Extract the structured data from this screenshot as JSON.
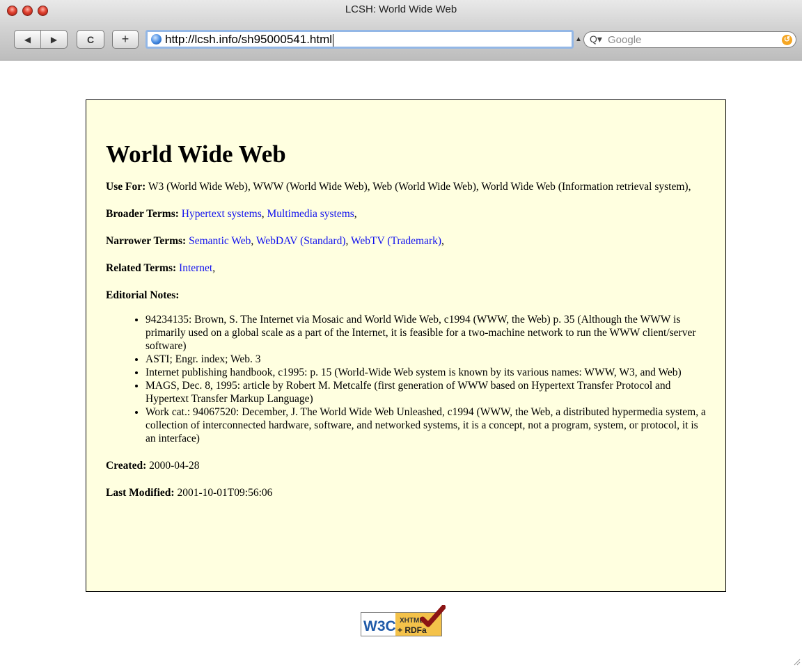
{
  "window": {
    "title": "LCSH: World Wide Web"
  },
  "toolbar": {
    "back_icon": "◀",
    "forward_icon": "▶",
    "reload_icon": "C",
    "add_icon": "+",
    "url": "http://lcsh.info/sh95000541.html",
    "search_placeholder": "Google"
  },
  "page": {
    "heading": "World Wide Web",
    "use_for": {
      "label": "Use For:",
      "value": "W3 (World Wide Web), WWW (World Wide Web), Web (World Wide Web), World Wide Web (Information retrieval system),"
    },
    "broader": {
      "label": "Broader Terms:",
      "links": [
        "Hypertext systems",
        "Multimedia systems"
      ]
    },
    "narrower": {
      "label": "Narrower Terms:",
      "links": [
        "Semantic Web",
        "WebDAV (Standard)",
        "WebTV (Trademark)"
      ]
    },
    "related": {
      "label": "Related Terms:",
      "links": [
        "Internet"
      ]
    },
    "editorial": {
      "label": "Editorial Notes:",
      "notes": [
        "94234135: Brown, S. The Internet via Mosaic and World Wide Web, c1994 (WWW, the Web) p. 35 (Although the WWW is primarily used on a global scale as a part of the Internet, it is feasible for a two-machine network to run the WWW client/server software)",
        "ASTI; Engr. index; Web. 3",
        "Internet publishing handbook, c1995: p. 15 (World-Wide Web system is known by its various names: WWW, W3, and Web)",
        "MAGS, Dec. 8, 1995: article by Robert M. Metcalfe (first generation of WWW based on Hypertext Transfer Protocol and Hypertext Transfer Markup Language)",
        "Work cat.: 94067520: December, J. The World Wide Web Unleashed, c1994 (WWW, the Web, a distributed hypermedia system, a collection of interconnected hardware, software, and networked systems, it is a concept, not a program, system, or protocol, it is an interface)"
      ]
    },
    "created": {
      "label": "Created:",
      "value": "2000-04-28"
    },
    "modified": {
      "label": "Last Modified:",
      "value": "2001-10-01T09:56:06"
    },
    "sep": ",",
    "badge": {
      "left": "W3C",
      "top": "XHTML",
      "bottom": "+ RDFa"
    }
  },
  "colors": {
    "page_bg": "#ffffe0",
    "link": "#1111ee",
    "url_focus": "#93b7e6"
  }
}
